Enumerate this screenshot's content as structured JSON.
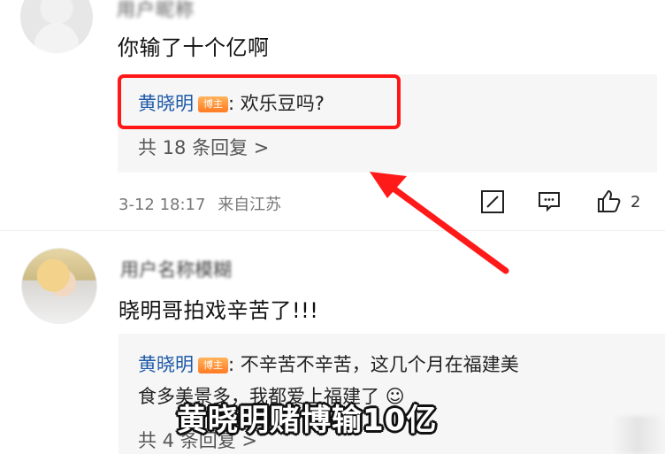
{
  "first_comment": {
    "text": "你输了十个亿啊",
    "reply": {
      "author": "黄晓明",
      "badge": "博主",
      "content": ": 欢乐豆吗?",
      "count": "共 18 条回复 >"
    },
    "meta": {
      "time": "3-12 18:17",
      "location": "来自江苏",
      "likes": "2"
    }
  },
  "second_comment": {
    "text": "晓明哥拍戏辛苦了!!!",
    "reply": {
      "author": "黄晓明",
      "badge": "博主",
      "content_line1": ": 不辛苦不辛苦，这几个月在福建美",
      "content_line2": "食多美景多，我都爱上福建了",
      "count": "共 4 条回复 >"
    }
  },
  "overlay_caption": "黄晓明赌博输10亿",
  "colors": {
    "highlight": "#ff1616",
    "arrow": "#ff1a1a",
    "name": "#1e5aa8",
    "badge": "#ff8a2a"
  }
}
